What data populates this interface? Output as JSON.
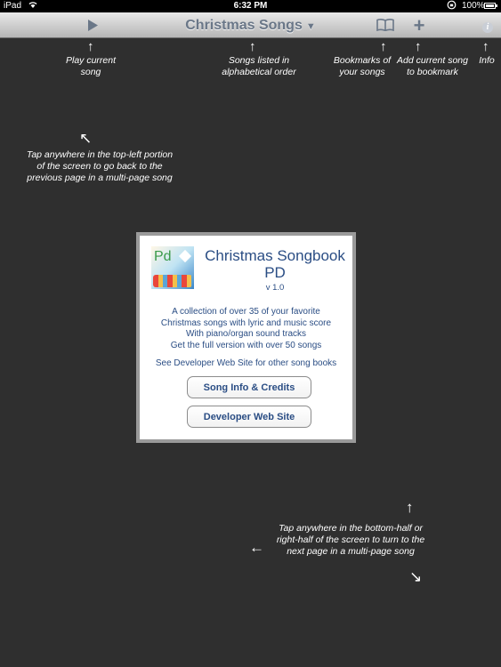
{
  "status": {
    "carrier": "iPad",
    "time": "6:32 PM",
    "battery": "100%"
  },
  "nav": {
    "title": "Christmas Songs",
    "title_caret": "▼",
    "plus_glyph": "+",
    "info_glyph": "i"
  },
  "callouts": {
    "play": "Play current song",
    "songs": "Songs listed in alphabetical order",
    "bookmarks": "Bookmarks of your songs",
    "add": "Add current song to bookmark",
    "info": "Info",
    "prev": "Tap anywhere in the top-left portion of the screen to go back to the previous page in a multi-page song",
    "next": "Tap anywhere in the bottom-half or right-half of the screen to turn to the next page in a multi-page song"
  },
  "arrows": {
    "up": "↑",
    "up_left": "↖",
    "left": "←",
    "down_right": "↘"
  },
  "dialog": {
    "icon_text": "Pd",
    "title": "Christmas Songbook PD",
    "version": "v 1.0",
    "body": [
      "A collection of over 35 of your favorite",
      "Christmas songs with lyric and music score",
      "With piano/organ sound tracks",
      "Get the full version with over 50 songs"
    ],
    "link": "See Developer Web Site for other song books",
    "button_credits": "Song Info & Credits",
    "button_website": "Developer Web Site"
  },
  "icons": [
    "wifi-icon",
    "lock-rotation-icon",
    "battery-icon",
    "play-icon",
    "bookmarks-book-icon",
    "add-plus-icon",
    "info-icon",
    "app-icon"
  ]
}
